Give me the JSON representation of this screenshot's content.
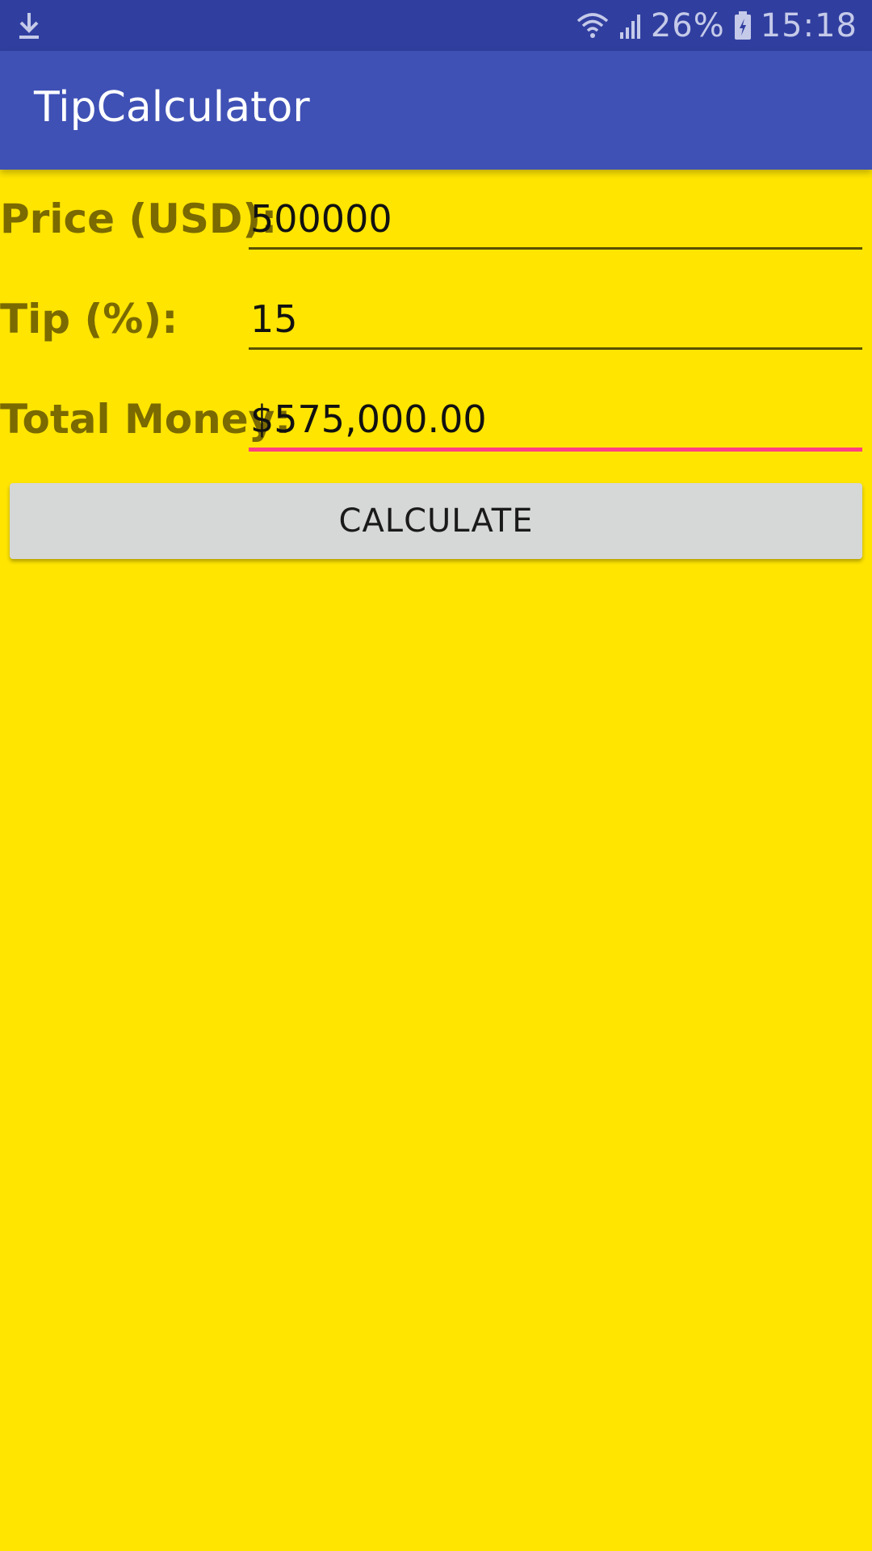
{
  "status_bar": {
    "battery": "26%",
    "time": "15:18",
    "icons": [
      "download-icon",
      "wifi-icon",
      "signal-icon",
      "battery-icon"
    ]
  },
  "app_bar": {
    "title": "TipCalculator"
  },
  "form": {
    "price": {
      "label": "Price (USD):",
      "value": "500000"
    },
    "tip": {
      "label": "Tip (%):",
      "value": "15"
    },
    "total": {
      "label": "Total Money:",
      "value": "$575,000.00"
    }
  },
  "button": {
    "label": "CALCULATE"
  },
  "colors": {
    "background": "#FFE500",
    "status_bar": "#303F9F",
    "app_bar": "#3F51B5",
    "accent": "#FF4081",
    "label": "#7A6A00",
    "button": "#D6D7D7"
  }
}
